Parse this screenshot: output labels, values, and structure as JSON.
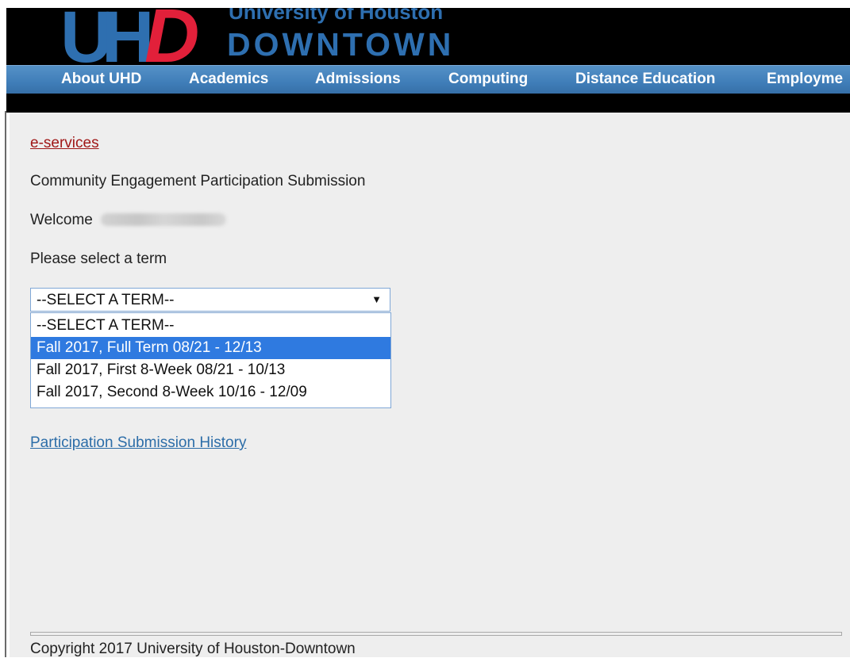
{
  "header": {
    "logo_letters_1": "U",
    "logo_letters_2": "H",
    "logo_letters_3": "D",
    "university_line": "University of Houston",
    "campus_line": "DOWNTOWN"
  },
  "nav": {
    "items": [
      {
        "label": "About UHD"
      },
      {
        "label": "Academics"
      },
      {
        "label": "Admissions"
      },
      {
        "label": "Computing"
      },
      {
        "label": "Distance Education"
      },
      {
        "label": "Employme"
      }
    ]
  },
  "content": {
    "breadcrumb_link": "e-services",
    "page_title": "Community Engagement Participation Submission",
    "welcome_label": "Welcome",
    "prompt": "Please select a term",
    "term_select": {
      "value": "--SELECT A TERM--",
      "arrow_icon": "triangle-down-icon",
      "options": [
        {
          "label": "--SELECT A TERM--"
        },
        {
          "label": "Fall 2017, Full Term 08/21 - 12/13"
        },
        {
          "label": "Fall 2017, First 8-Week 08/21 - 10/13"
        },
        {
          "label": "Fall 2017, Second 8-Week 10/16 - 12/09"
        }
      ],
      "highlighted_option": "Fall 2017, Full Term 08/21 - 12/13"
    },
    "history_link": "Participation Submission History"
  },
  "footer": {
    "copyright": "Copyright 2017 University of Houston-Downtown"
  },
  "colors": {
    "brand_blue": "#2e6fb0",
    "brand_red": "#e2203a",
    "nav_blue": "#3f7db8",
    "selection_blue": "#2f7ae0",
    "link_red": "#a01818"
  }
}
